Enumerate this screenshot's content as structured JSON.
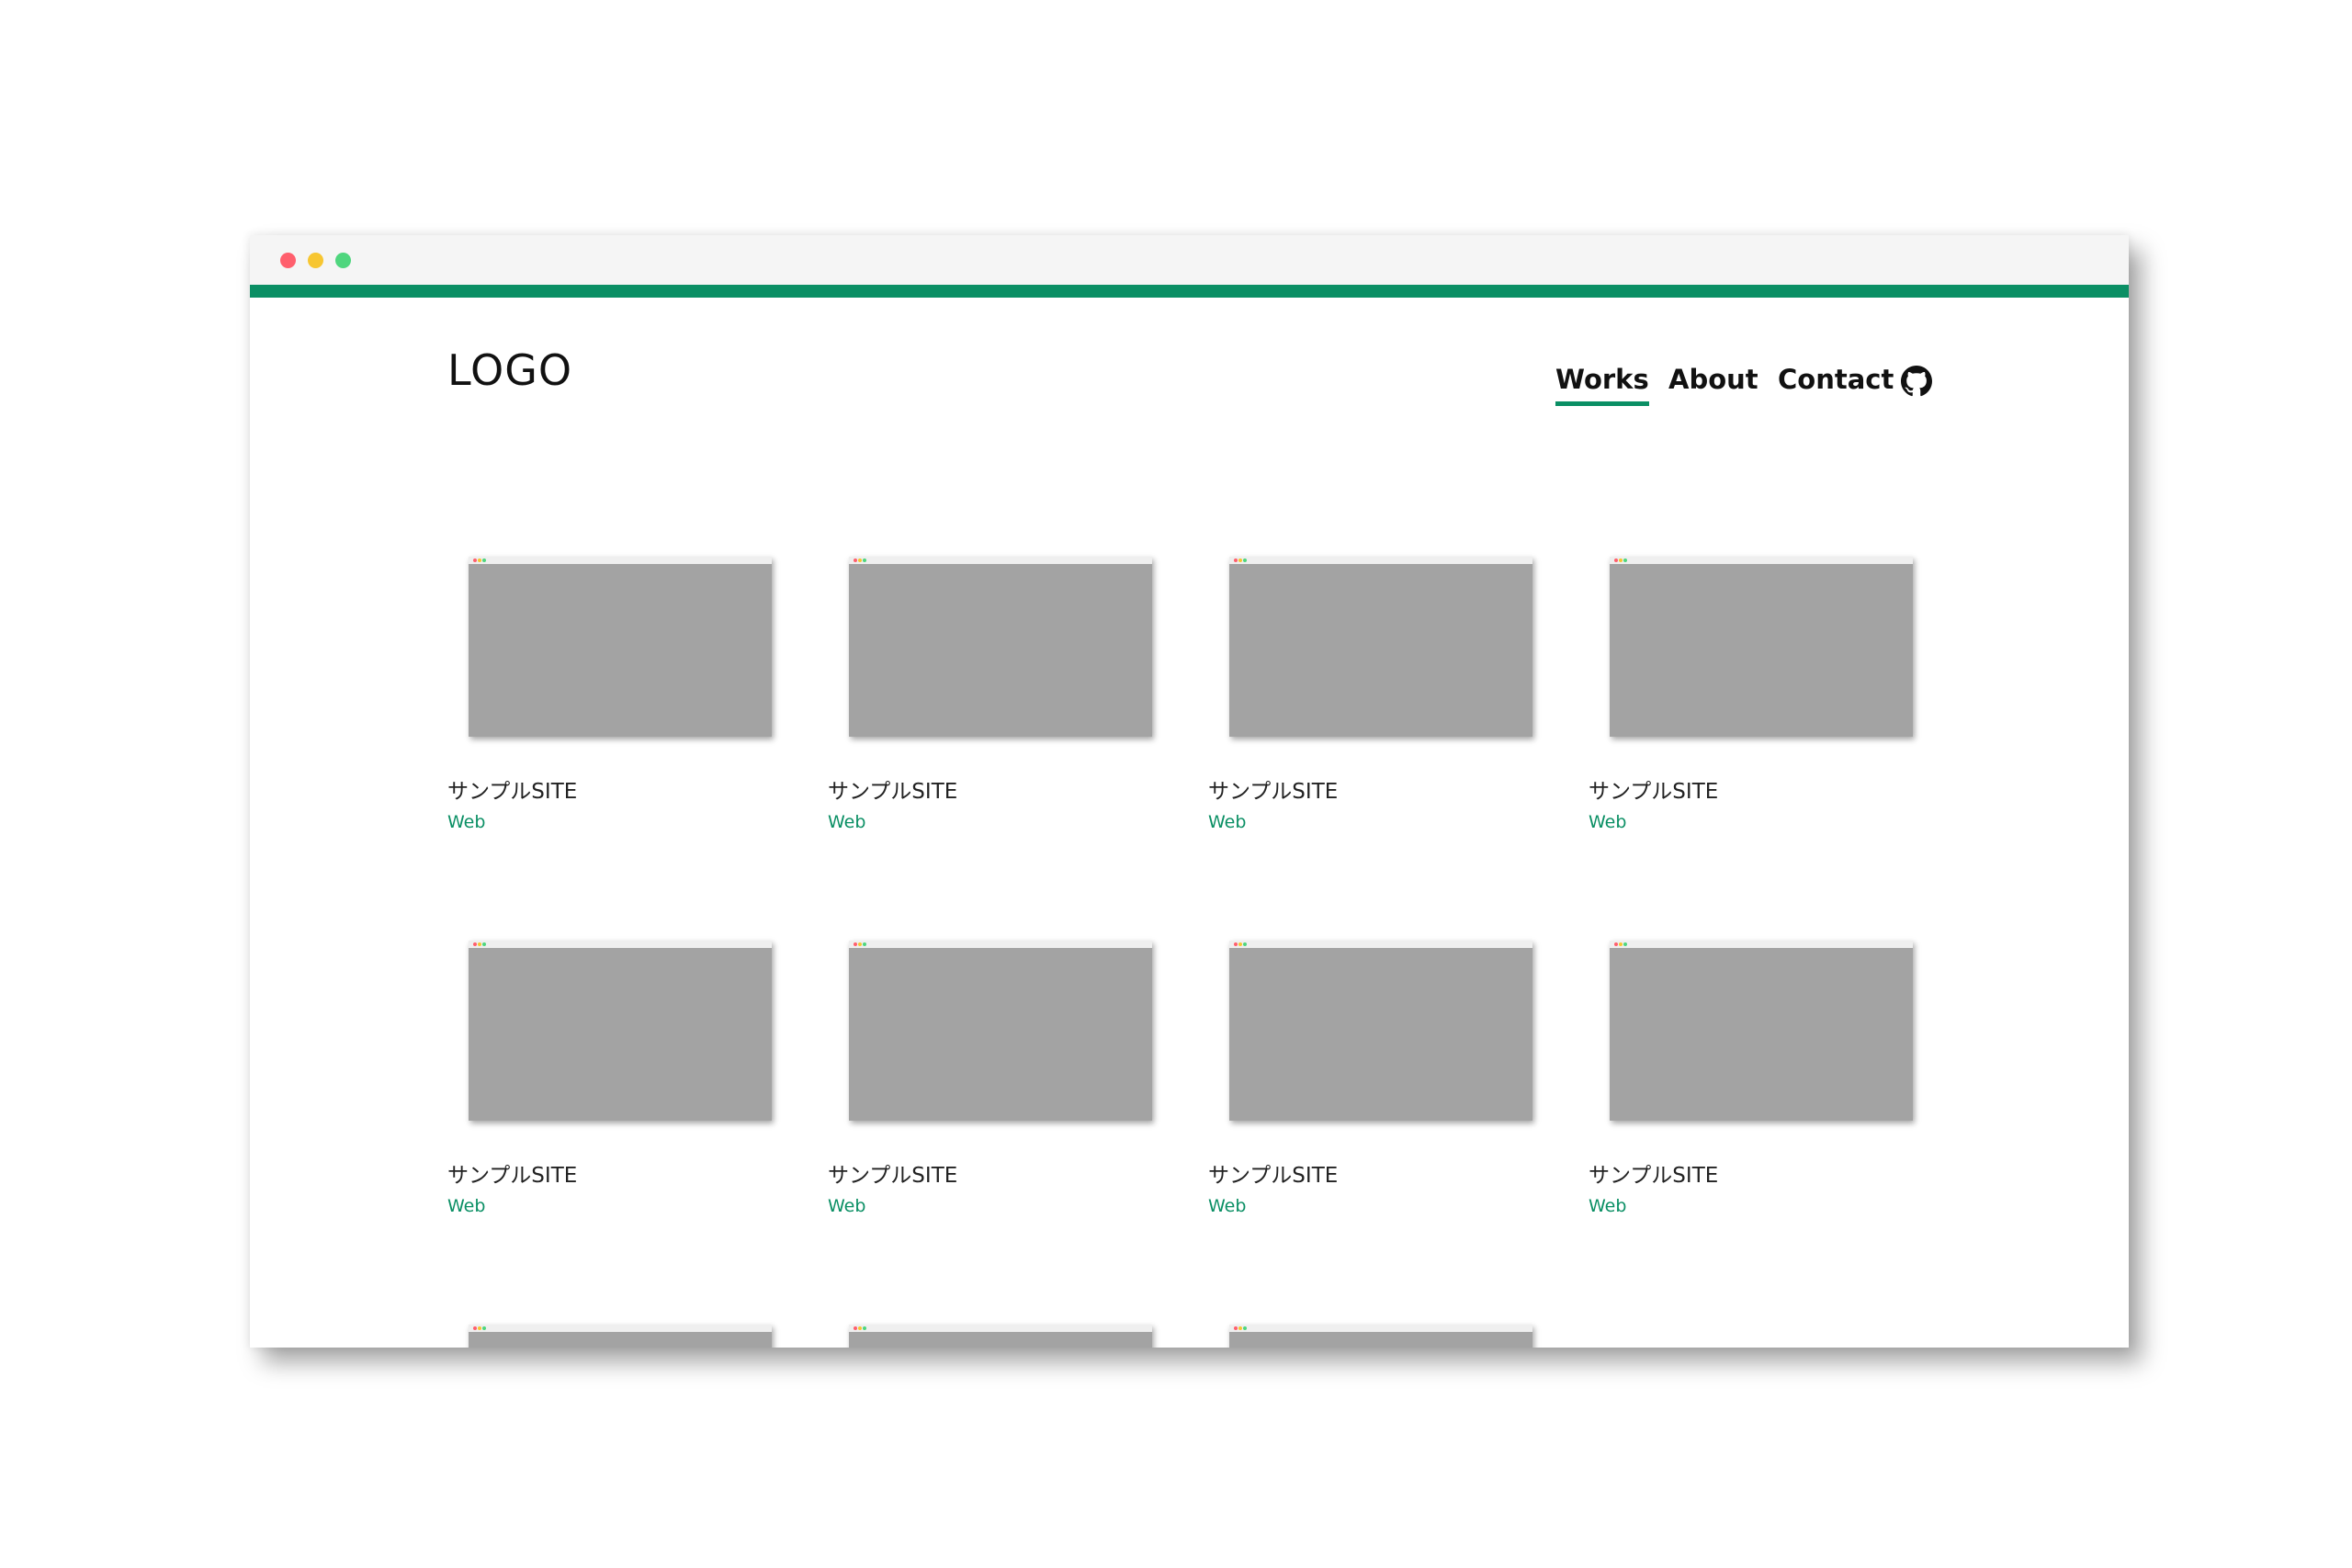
{
  "window": {
    "traffic_lights": [
      "#ff5f6d",
      "#f7c631",
      "#4fd67e"
    ]
  },
  "colors": {
    "accent": "#0a8f64",
    "thumb_bg": "#a3a3a3"
  },
  "header": {
    "logo": "LOGO"
  },
  "nav": {
    "items": [
      {
        "label": "Works",
        "active": true
      },
      {
        "label": "About",
        "active": false
      },
      {
        "label": "Contact",
        "active": false
      }
    ],
    "github_icon": "github-icon"
  },
  "works": {
    "items": [
      {
        "title": "サンプルSITE",
        "category": "Web"
      },
      {
        "title": "サンプルSITE",
        "category": "Web"
      },
      {
        "title": "サンプルSITE",
        "category": "Web"
      },
      {
        "title": "サンプルSITE",
        "category": "Web"
      },
      {
        "title": "サンプルSITE",
        "category": "Web"
      },
      {
        "title": "サンプルSITE",
        "category": "Web"
      },
      {
        "title": "サンプルSITE",
        "category": "Web"
      },
      {
        "title": "サンプルSITE",
        "category": "Web"
      },
      {
        "title": "",
        "category": ""
      },
      {
        "title": "",
        "category": ""
      },
      {
        "title": "",
        "category": ""
      }
    ]
  }
}
